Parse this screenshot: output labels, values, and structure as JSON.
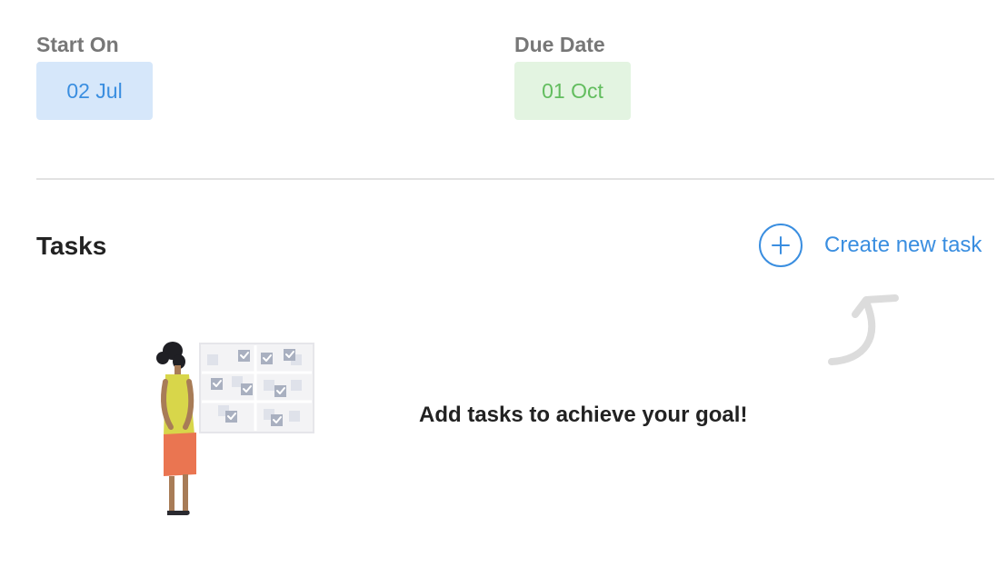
{
  "dates": {
    "start": {
      "label": "Start On",
      "value": "02 Jul"
    },
    "due": {
      "label": "Due Date",
      "value": "01 Oct"
    }
  },
  "tasks": {
    "title": "Tasks",
    "create_label": "Create new task",
    "create_icon": "plus-circle-icon",
    "empty_message": "Add tasks to achieve your goal!"
  },
  "colors": {
    "accent_blue": "#3a8ee0",
    "start_chip_bg": "#d6e7fa",
    "due_green": "#62bd5e",
    "due_chip_bg": "#e3f4e1"
  }
}
